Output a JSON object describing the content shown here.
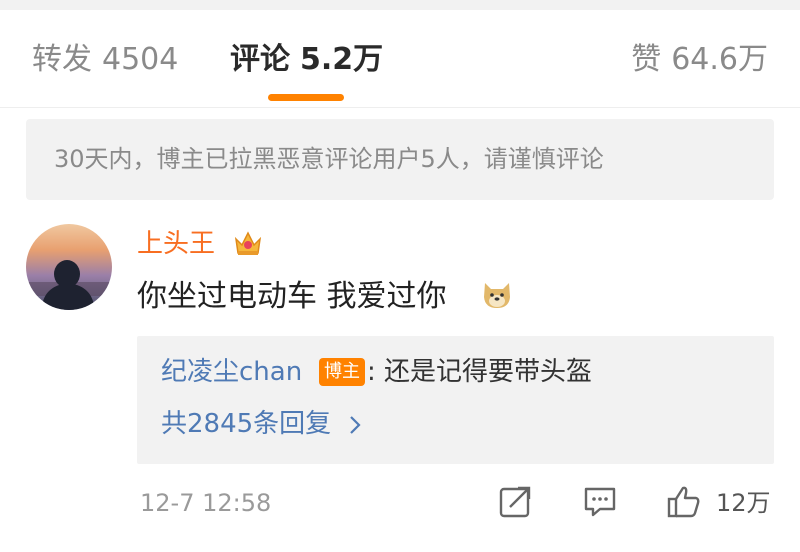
{
  "tabs": {
    "repost": {
      "label": "转发",
      "count": "4504"
    },
    "comment": {
      "label": "评论",
      "count": "5.2万"
    },
    "like": {
      "label": "赞",
      "count": "64.6万"
    }
  },
  "notice": "30天内，博主已拉黑恶意评论用户5人，请谨慎评论",
  "comment": {
    "username": "上头王",
    "text": "你坐过电动车 我爱过你",
    "reply": {
      "author": "纪凌尘chan",
      "badge": "博主",
      "text": ": 还是记得要带头盔",
      "more": "共2845条回复"
    },
    "timestamp": "12-7 12:58",
    "like_count": "12万"
  },
  "colors": {
    "accent": "#ff8200",
    "username": "#f86e21",
    "link": "#4f7ab5"
  }
}
